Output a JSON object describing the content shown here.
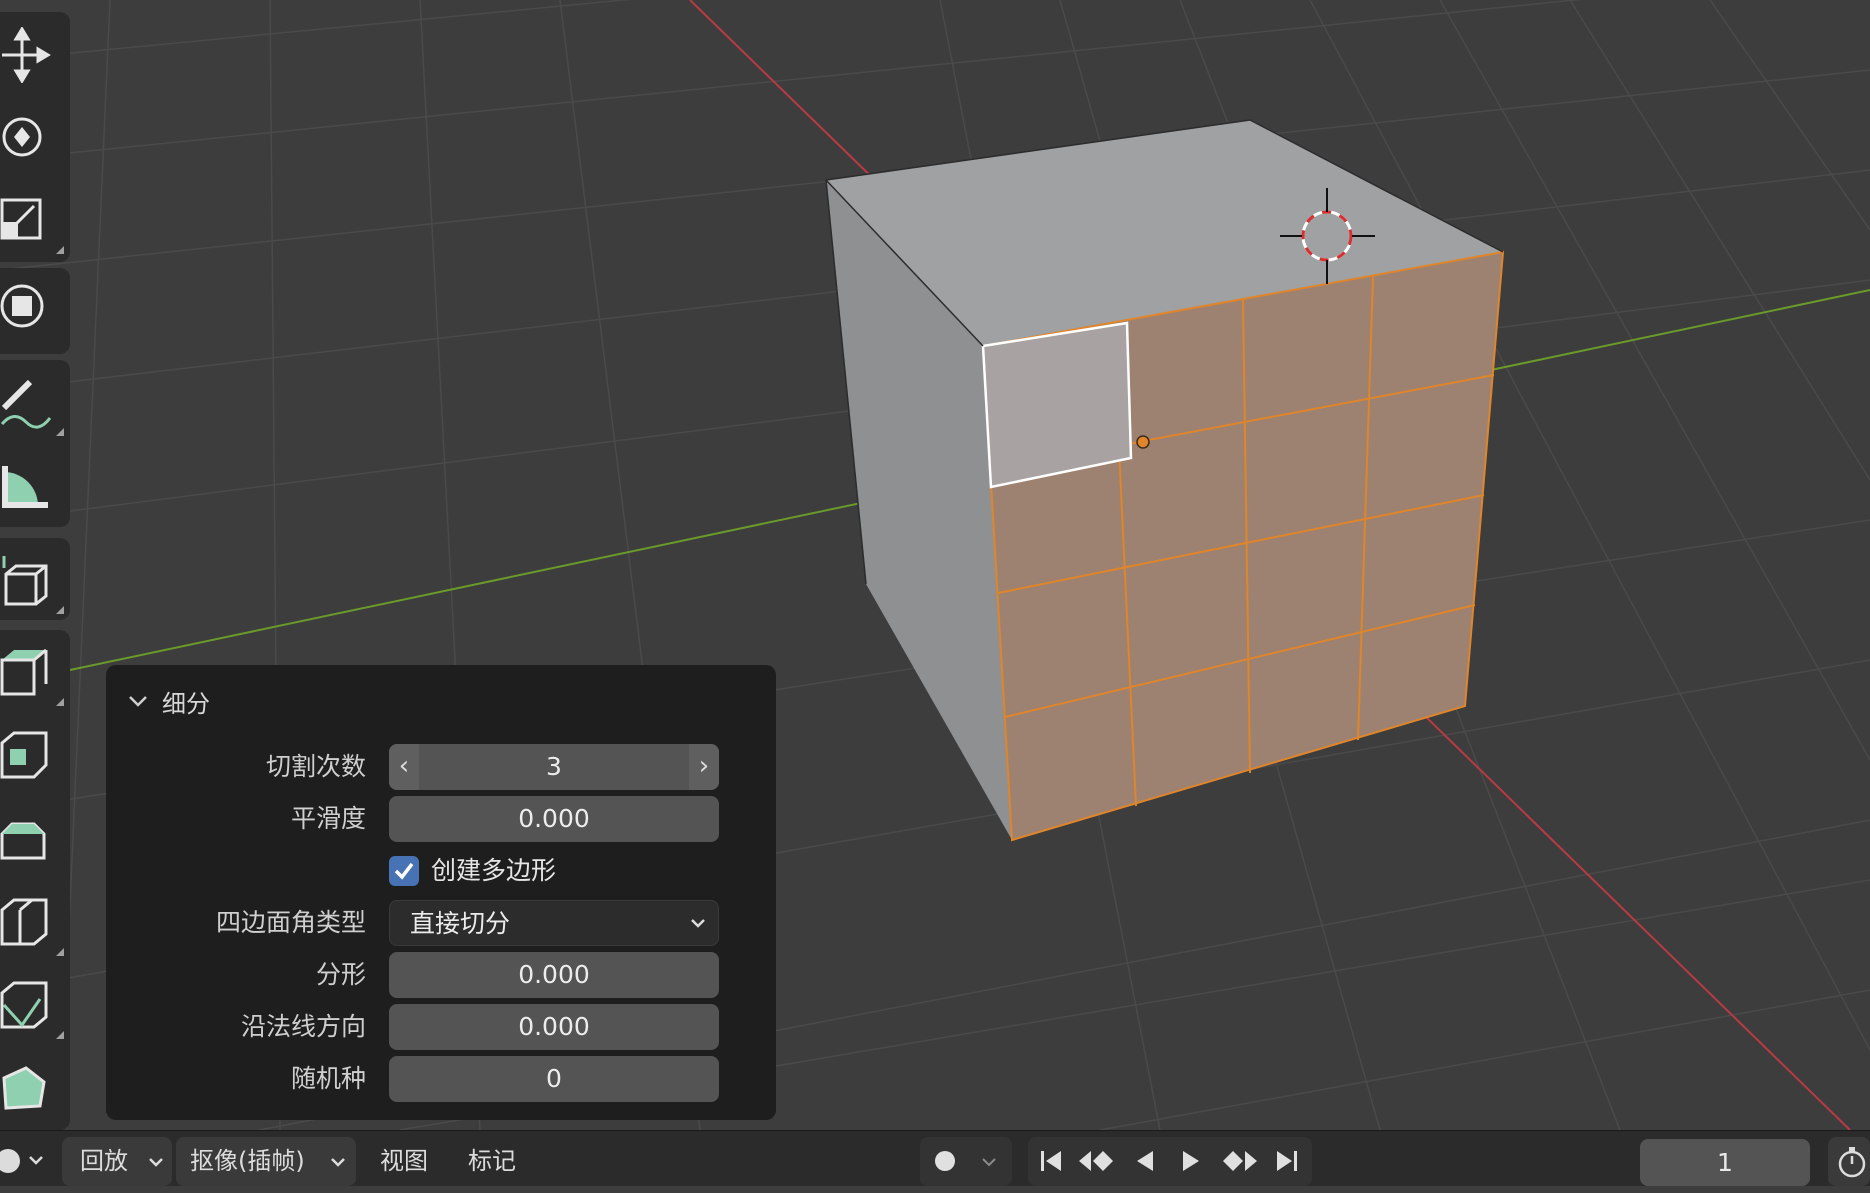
{
  "toolbar": {
    "tools": [
      "move-tool",
      "rotate-tool",
      "scale-tool",
      "transform-tool",
      "annotate-tool",
      "measure-tool",
      "add-cube-tool",
      "extrude-tool",
      "inset-tool",
      "bevel-tool",
      "loop-cut-tool",
      "knife-tool",
      "poly-build-tool"
    ]
  },
  "operator_panel": {
    "title": "细分",
    "number_of_cuts_label": "切割次数",
    "number_of_cuts_value": "3",
    "smoothness_label": "平滑度",
    "smoothness_value": "0.000",
    "create_ngons_label": "创建多边形",
    "create_ngons_checked": true,
    "quad_corner_type_label": "四边面角类型",
    "quad_corner_type_value": "直接切分",
    "fractal_label": "分形",
    "fractal_value": "0.000",
    "along_normal_label": "沿法线方向",
    "along_normal_value": "0.000",
    "random_seed_label": "随机种",
    "random_seed_value": "0"
  },
  "timeline": {
    "playback_label": "回放",
    "keying_label": "抠像(插帧)",
    "view_label": "视图",
    "marker_label": "标记",
    "current_frame": "1"
  },
  "colors": {
    "viewport_bg": "#3d3d3d",
    "selection_orange": "#e0852a",
    "x_axis": "#b83a45",
    "y_axis": "#6a9a2a",
    "accent_blue": "#4772b3"
  }
}
